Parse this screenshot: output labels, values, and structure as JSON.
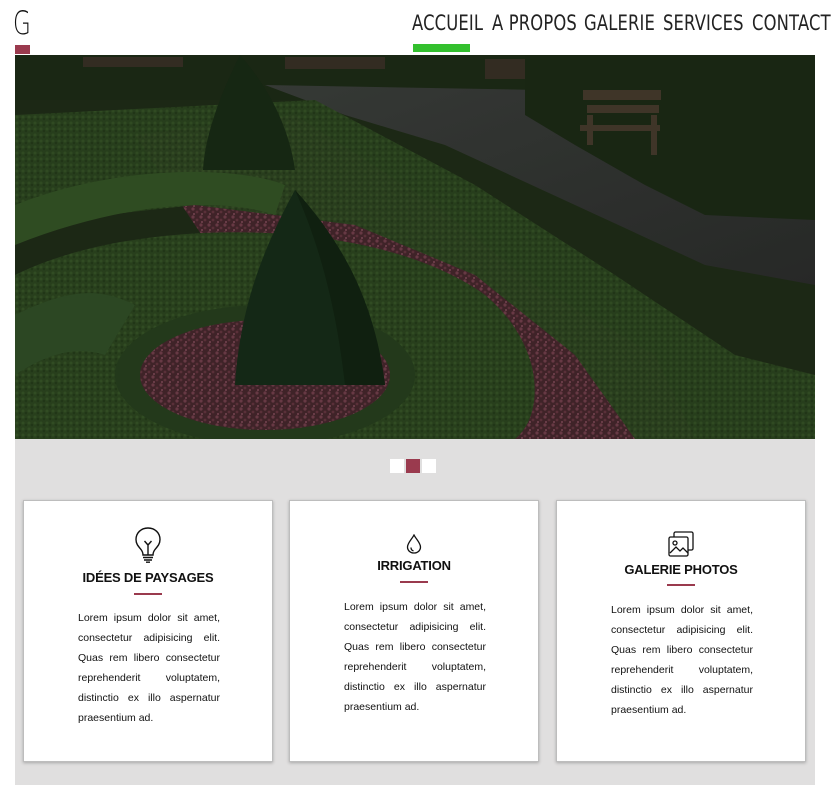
{
  "brand": {
    "logo_letter": "G",
    "accent_color": "#9a3a4e",
    "active_color": "#33c02e"
  },
  "nav": {
    "items": [
      {
        "label": "ACCUEIL",
        "active": true
      },
      {
        "label": "A PROPOS",
        "active": false
      },
      {
        "label": "GALERIE",
        "active": false
      },
      {
        "label": "SERVICES",
        "active": false
      },
      {
        "label": "CONTACT",
        "active": false
      }
    ]
  },
  "slider": {
    "slide_count": 3,
    "active_index": 1
  },
  "cards": [
    {
      "icon": "lightbulb-icon",
      "title": "IDÉES DE PAYSAGES",
      "text": "Lorem ipsum dolor sit amet, consectetur adipisicing elit. Quas rem libero consectetur reprehenderit voluptatem, distinctio ex illo aspernatur praesentium ad."
    },
    {
      "icon": "water-drop-icon",
      "title": "IRRIGATION",
      "text": "Lorem ipsum dolor sit amet, consectetur adipisicing elit. Quas rem libero consectetur reprehenderit voluptatem, distinctio ex illo aspernatur praesentium ad."
    },
    {
      "icon": "photo-gallery-icon",
      "title": "GALERIE PHOTOS",
      "text": "Lorem ipsum dolor sit amet, consectetur adipisicing elit. Quas rem libero consectetur reprehenderit voluptatem, distinctio ex illo aspernatur praesentium ad."
    }
  ]
}
